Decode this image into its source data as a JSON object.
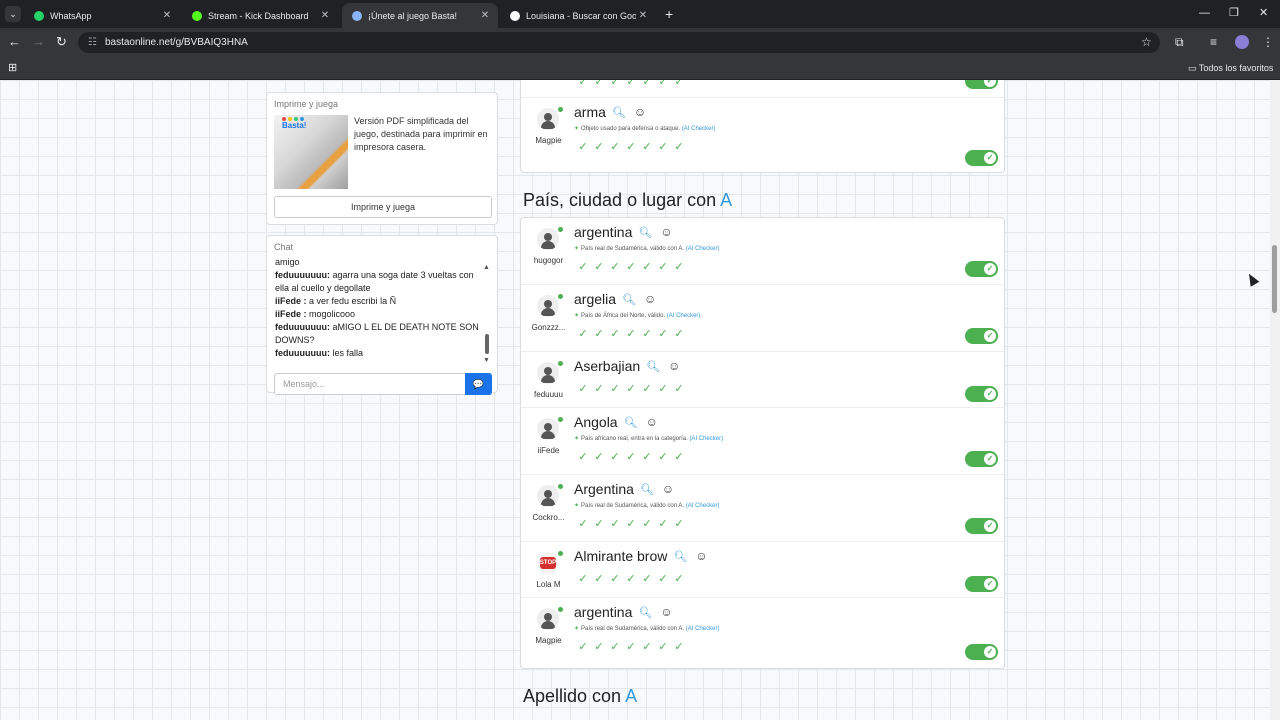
{
  "browser": {
    "tabs": [
      {
        "title": "WhatsApp",
        "favicon_color": "#25d366",
        "active": false
      },
      {
        "title": "Stream - Kick Dashboard",
        "favicon_color": "#53fc18",
        "active": false
      },
      {
        "title": "¡Únete al juego Basta!",
        "favicon_color": "#8ab4f8",
        "active": true
      },
      {
        "title": "Louisiana - Buscar con Google",
        "favicon_color": "#ffffff",
        "active": false
      }
    ],
    "url": "bastaonline.net/g/BVBAIQ3HNA",
    "bookmarks_label": "Todos los favoritos"
  },
  "print_card": {
    "title": "Imprime y juega",
    "description": "Versión PDF simplificada del juego, destinada para imprimir en impresora casera.",
    "button_label": "Imprime y juega",
    "thumb_logo": "Basta!"
  },
  "chat": {
    "title": "Chat",
    "messages": [
      {
        "user": "",
        "text": "amigo"
      },
      {
        "user": "feduuuuuuu:",
        "text": "agarra una soga date 3 vueltas con ella al cuello y degollate"
      },
      {
        "user": "iiFede :",
        "text": "a ver fedu escribi la Ñ"
      },
      {
        "user": "iiFede :",
        "text": "mogolicooo"
      },
      {
        "user": "feduuuuuuu:",
        "text": "aMIGO L EL DE DEATH NOTE SON DOWNS?"
      },
      {
        "user": "feduuuuuuu:",
        "text": "les falla"
      }
    ],
    "input_placeholder": "Mensajo..."
  },
  "top_section": {
    "rows": [
      {
        "user": "",
        "word": "",
        "note": "",
        "checks": 7,
        "valid": true
      },
      {
        "user": "Magpie",
        "word": "arma",
        "note": "Objeto usado para defensa o ataque.",
        "ai": "(AI Checker)",
        "checks": 7,
        "valid": true
      }
    ]
  },
  "section_pais": {
    "title": "País, ciudad o lugar con",
    "letter": "A",
    "rows": [
      {
        "user": "hugogor",
        "avatar": "person",
        "word": "argentina",
        "note": "País real de Sudamérica, válido con A.",
        "ai": "(AI Checker)",
        "checks": 7,
        "valid": true
      },
      {
        "user": "Gonzzz...",
        "avatar": "person",
        "word": "argelia",
        "note": "País de África del Norte, válido.",
        "ai": "(AI Checker)",
        "checks": 7,
        "valid": true
      },
      {
        "user": "feduuuu",
        "avatar": "person",
        "word": "Aserbajian",
        "note": "",
        "ai": "",
        "checks": 7,
        "valid": true
      },
      {
        "user": "iiFede",
        "avatar": "person",
        "word": "Angola",
        "note": "País africano real, entra en la categoría.",
        "ai": "(AI Checker)",
        "checks": 7,
        "valid": true
      },
      {
        "user": "Cockro...",
        "avatar": "person",
        "word": "Argentina",
        "note": "País real de Sudamérica, válido con A.",
        "ai": "(AI Checker)",
        "checks": 7,
        "valid": true
      },
      {
        "user": "Lola M",
        "avatar": "stop",
        "word": "Almirante brow",
        "note": "",
        "ai": "",
        "checks": 7,
        "valid": true
      },
      {
        "user": "Magpie",
        "avatar": "person",
        "word": "argentina",
        "note": "País real de Sudamérica, válido con A.",
        "ai": "(AI Checker)",
        "checks": 7,
        "valid": true
      }
    ]
  },
  "section_apellido": {
    "title": "Apellido con",
    "letter": "A"
  },
  "icons": {
    "search": "magnifier-icon",
    "emoji": "smiley-icon",
    "check": "check-icon",
    "toggle": "toggle-on-icon"
  },
  "colors": {
    "accent": "#3498db",
    "valid_green": "#4caf50",
    "send_blue": "#1a73e8"
  }
}
